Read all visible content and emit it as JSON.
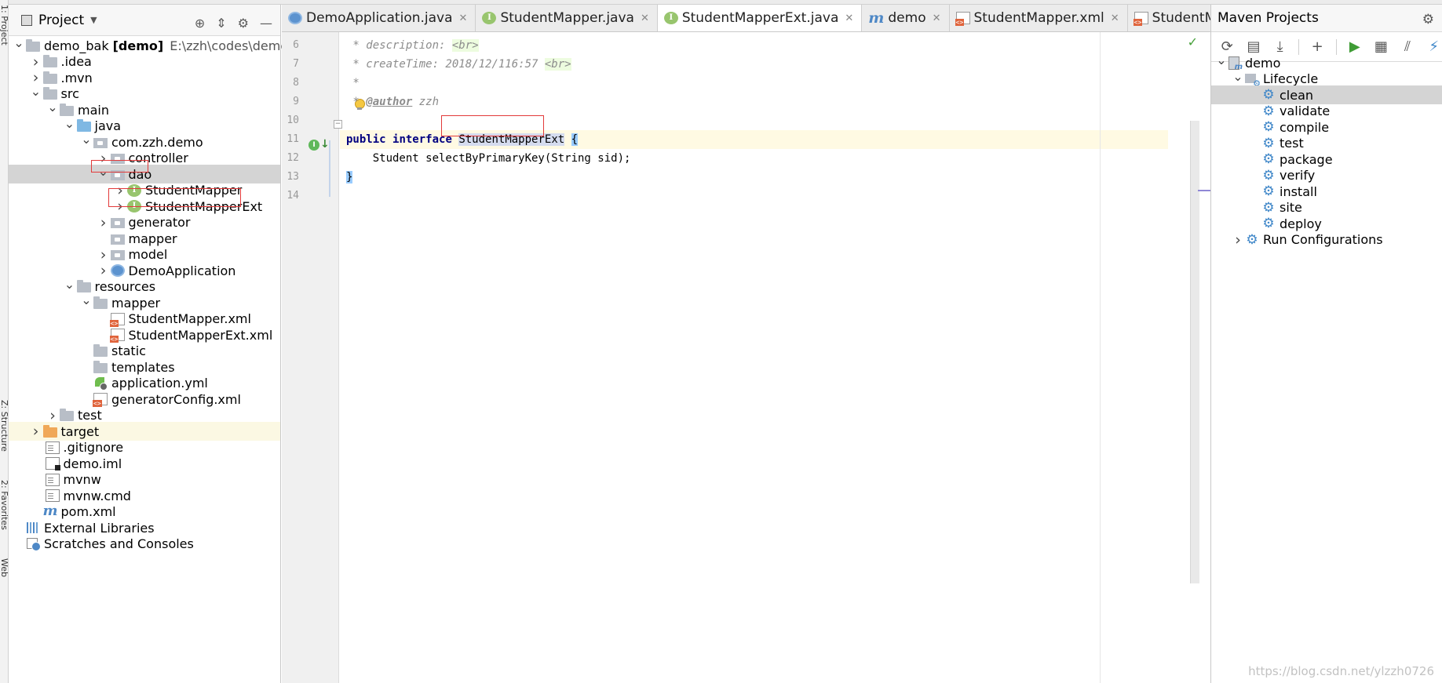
{
  "left_stripe": {
    "labels": [
      "1: Project",
      "Z: Structure",
      "2: Favorites",
      "Web"
    ]
  },
  "project_panel": {
    "title": "Project",
    "tree": [
      {
        "label": "demo_bak",
        "module": "[demo]",
        "path": "E:\\zzh\\codes\\demo\\de",
        "depth": 0,
        "arrow": "down",
        "icon": "project"
      },
      {
        "label": ".idea",
        "depth": 1,
        "arrow": "right",
        "icon": "folder"
      },
      {
        "label": ".mvn",
        "depth": 1,
        "arrow": "right",
        "icon": "folder"
      },
      {
        "label": "src",
        "depth": 1,
        "arrow": "down",
        "icon": "folder"
      },
      {
        "label": "main",
        "depth": 2,
        "arrow": "down",
        "icon": "folder"
      },
      {
        "label": "java",
        "depth": 3,
        "arrow": "down",
        "icon": "folder-blue"
      },
      {
        "label": "com.zzh.demo",
        "depth": 4,
        "arrow": "down",
        "icon": "package"
      },
      {
        "label": "controller",
        "depth": 5,
        "arrow": "right",
        "icon": "package"
      },
      {
        "label": "dao",
        "depth": 5,
        "arrow": "down",
        "icon": "package",
        "selected": true
      },
      {
        "label": "StudentMapper",
        "depth": 6,
        "arrow": "right",
        "icon": "interface"
      },
      {
        "label": "StudentMapperExt",
        "depth": 6,
        "arrow": "right",
        "icon": "interface"
      },
      {
        "label": "generator",
        "depth": 5,
        "arrow": "right",
        "icon": "package"
      },
      {
        "label": "mapper",
        "depth": 5,
        "arrow": "none",
        "icon": "package"
      },
      {
        "label": "model",
        "depth": 5,
        "arrow": "right",
        "icon": "package"
      },
      {
        "label": "DemoApplication",
        "depth": 5,
        "arrow": "right",
        "icon": "class"
      },
      {
        "label": "resources",
        "depth": 3,
        "arrow": "down",
        "icon": "folder"
      },
      {
        "label": "mapper",
        "depth": 4,
        "arrow": "down",
        "icon": "folder"
      },
      {
        "label": "StudentMapper.xml",
        "depth": 5,
        "arrow": "none",
        "icon": "xml"
      },
      {
        "label": "StudentMapperExt.xml",
        "depth": 5,
        "arrow": "none",
        "icon": "xml"
      },
      {
        "label": "static",
        "depth": 4,
        "arrow": "none",
        "icon": "folder"
      },
      {
        "label": "templates",
        "depth": 4,
        "arrow": "none",
        "icon": "folder"
      },
      {
        "label": "application.yml",
        "depth": 4,
        "arrow": "none",
        "icon": "yml"
      },
      {
        "label": "generatorConfig.xml",
        "depth": 4,
        "arrow": "none",
        "icon": "xml"
      },
      {
        "label": "test",
        "depth": 2,
        "arrow": "right",
        "icon": "folder"
      },
      {
        "label": "target",
        "depth": 1,
        "arrow": "right",
        "icon": "folder-orange",
        "highlight": true
      },
      {
        "label": ".gitignore",
        "depth": 1,
        "arrow": "none",
        "icon": "file"
      },
      {
        "label": "demo.iml",
        "depth": 1,
        "arrow": "none",
        "icon": "iml"
      },
      {
        "label": "mvnw",
        "depth": 1,
        "arrow": "none",
        "icon": "file"
      },
      {
        "label": "mvnw.cmd",
        "depth": 1,
        "arrow": "none",
        "icon": "file"
      },
      {
        "label": "pom.xml",
        "depth": 1,
        "arrow": "none",
        "icon": "maven"
      },
      {
        "label": "External Libraries",
        "depth": 0,
        "arrow": "none",
        "icon": "libs"
      },
      {
        "label": "Scratches and Consoles",
        "depth": 0,
        "arrow": "none",
        "icon": "scratch"
      }
    ]
  },
  "editor": {
    "tabs": [
      {
        "label": "DemoApplication.java",
        "icon": "class",
        "active": false
      },
      {
        "label": "StudentMapper.java",
        "icon": "interface",
        "active": false
      },
      {
        "label": "StudentMapperExt.java",
        "icon": "interface",
        "active": true
      },
      {
        "label": "demo",
        "icon": "maven",
        "active": false
      },
      {
        "label": "StudentMapper.xml",
        "icon": "xml",
        "active": false
      },
      {
        "label": "StudentMapperExt.xml",
        "icon": "xml",
        "active": false
      }
    ],
    "line_numbers": [
      "6",
      "7",
      "8",
      "9",
      "10",
      "11",
      "12",
      "13",
      "14"
    ],
    "code": {
      "l6_comment": " * description: ",
      "l6_tag": "<br>",
      "l7_comment": " * createTime: 2018/12/116:57 ",
      "l7_tag": "<br>",
      "l8_comment": " *",
      "l9_prefix": " * ",
      "l9_doc_tag": "@author",
      "l9_value": " zzh",
      "l11_kw1": "public",
      "l11_kw2": "interface",
      "l11_name": "StudentMapperExt",
      "l11_brace": "{",
      "l12_code": "    Student selectByPrimaryKey(String sid);",
      "l13_brace": "}"
    }
  },
  "maven_panel": {
    "title": "Maven Projects",
    "root": "demo",
    "lifecycle_label": "Lifecycle",
    "lifecycle": [
      "clean",
      "validate",
      "compile",
      "test",
      "package",
      "verify",
      "install",
      "site",
      "deploy"
    ],
    "selected": "clean",
    "run_configurations": "Run Configurations"
  },
  "watermark": "https://blog.csdn.net/ylzzh0726",
  "colors": {
    "selection": "#d4d4d4",
    "current_line": "#fffae3",
    "keyword": "#000080",
    "annotation_box": "#e23a3a"
  }
}
